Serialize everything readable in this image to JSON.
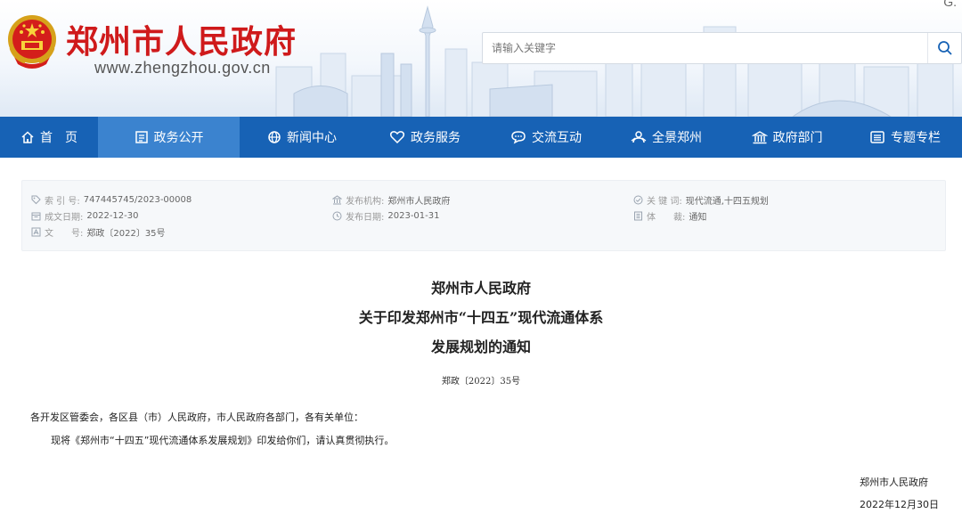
{
  "header": {
    "site_title": "郑州市人民政府",
    "site_url": "www.zhengzhou.gov.cn",
    "corner_text": "G.",
    "search_placeholder": "请输入关键字"
  },
  "nav": [
    {
      "label": "首　页",
      "icon": "home-icon"
    },
    {
      "label": "政务公开",
      "icon": "document-icon",
      "active": true
    },
    {
      "label": "新闻中心",
      "icon": "globe-icon"
    },
    {
      "label": "政务服务",
      "icon": "heart-icon"
    },
    {
      "label": "交流互动",
      "icon": "chat-icon"
    },
    {
      "label": "全景郑州",
      "icon": "people-icon"
    },
    {
      "label": "政府部门",
      "icon": "building-icon"
    },
    {
      "label": "专题专栏",
      "icon": "list-icon"
    }
  ],
  "info": {
    "index_label": "索 引 号:",
    "index_value": "747445745/2023-00008",
    "written_label": "成文日期:",
    "written_value": "2022-12-30",
    "docno_label": "文　　号:",
    "docno_value": "郑政〔2022〕35号",
    "issuer_label": "发布机构:",
    "issuer_value": "郑州市人民政府",
    "published_label": "发布日期:",
    "published_value": "2023-01-31",
    "keywords_label": "关 键 词:",
    "keywords_value": "现代流通,十四五规划",
    "genre_label": "体　　裁:",
    "genre_value": "通知"
  },
  "document": {
    "title_line1": "郑州市人民政府",
    "title_line2": "关于印发郑州市“十四五”现代流通体系",
    "title_line3": "发展规划的通知",
    "number": "郑政〔2022〕35号",
    "salutation": "各开发区管委会，各区县（市）人民政府，市人民政府各部门，各有关单位：",
    "body": "现将《郑州市“十四五”现代流通体系发展规划》印发给你们，请认真贯彻执行。",
    "signer": "郑州市人民政府",
    "date": "2022年12月30日"
  },
  "colors": {
    "brand_red": "#cf1a1b",
    "nav_blue": "#1762b5",
    "nav_active": "#3b83cf"
  }
}
